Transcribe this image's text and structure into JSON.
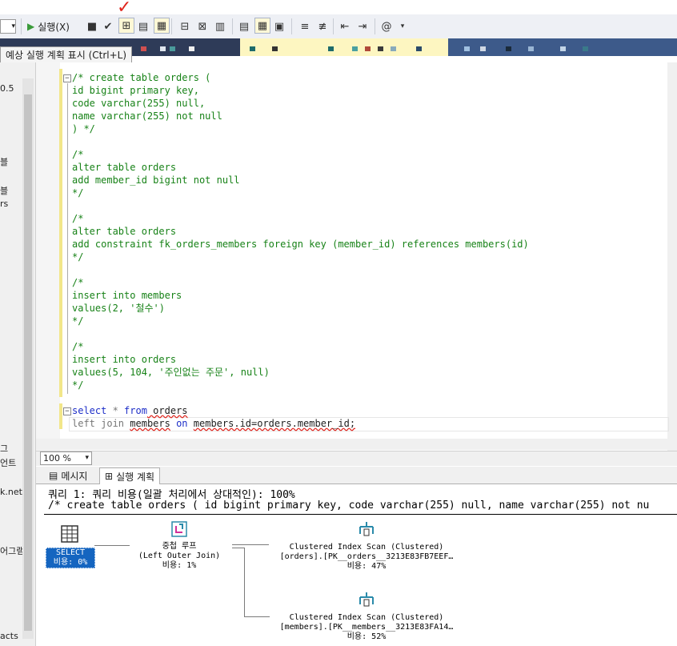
{
  "toolbar": {
    "run_label": "실행(X)",
    "tooltip": "예상 실행 계획 표시 (Ctrl+L)"
  },
  "explorer": {
    "fragments": [
      "0.5",
      "블",
      "블",
      "rs",
      "그",
      "언트",
      "k.net",
      "어그램",
      "acts"
    ]
  },
  "editor": {
    "lines": [
      "/* create table orders (",
      "id bigint primary key,",
      "code varchar(255) null,",
      "name varchar(255) not null",
      ") */",
      "",
      "/*",
      "alter table orders",
      "add member_id bigint not null",
      "*/",
      "",
      "/*",
      "alter table orders",
      "add constraint fk_orders_members foreign key (member_id) references members(id)",
      "*/",
      "",
      "/*",
      "insert into members",
      "values(2, '철수')",
      "*/",
      "",
      "/*",
      "insert into orders",
      "values(5, 104, '주인없는 주문', null)",
      "*/"
    ],
    "query_line1": {
      "select": "select",
      "star": " * ",
      "from": "from",
      "table": " orders"
    },
    "query_line2": {
      "left_join": "left join",
      "members": "members",
      "on": "on",
      "cond": "members.id=orders.member_id;"
    }
  },
  "zoom": {
    "value": "100 %"
  },
  "results": {
    "tab_messages": "메시지",
    "tab_plan": "실행 계획"
  },
  "plan": {
    "header_line1": "쿼리 1: 쿼리 비용(일괄 처리에서 상대적인): 100%",
    "header_line2": "/* create table orders ( id bigint primary key, code varchar(255) null, name varchar(255) not nu",
    "select_node": {
      "label": "SELECT",
      "cost": "비용: 0%"
    },
    "join_node": {
      "label": "중첩 루프",
      "sub": "(Left Outer Join)",
      "cost": "비용: 1%"
    },
    "scan1": {
      "label": "Clustered Index Scan (Clustered)",
      "object": "[orders].[PK__orders__3213E83FB7EEF…",
      "cost": "비용: 47%"
    },
    "scan2": {
      "label": "Clustered Index Scan (Clustered)",
      "object": "[members].[PK__members__3213E83FA14…",
      "cost": "비용: 52%"
    }
  },
  "colors": {
    "accent_red": "#e0241c",
    "keyword_blue": "#1d2ec8",
    "comment_green": "#178217",
    "select_blue": "#1565c0"
  }
}
